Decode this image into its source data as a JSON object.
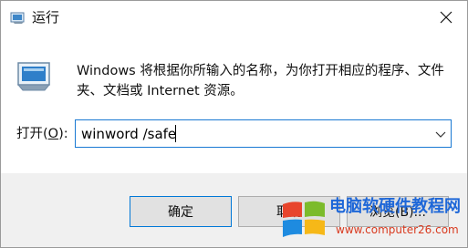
{
  "window": {
    "title": "运行",
    "close_icon": "close-icon"
  },
  "main": {
    "description": "Windows 将根据你所输入的名称，为你打开相应的程序、文件夹、文档或 Internet 资源。",
    "open_label_prefix": "打开(",
    "open_label_key": "O",
    "open_label_suffix": "):",
    "command_value": "winword /safe"
  },
  "buttons": {
    "ok": "确定",
    "cancel": "取消",
    "browse": "浏览(B)..."
  },
  "watermark": {
    "title": "电脑软硬件教程网",
    "url": "www.computer26.com"
  },
  "colors": {
    "accent": "#0078d7",
    "footer_bg": "#f0f0f0",
    "button_bg": "#e1e1e1"
  }
}
